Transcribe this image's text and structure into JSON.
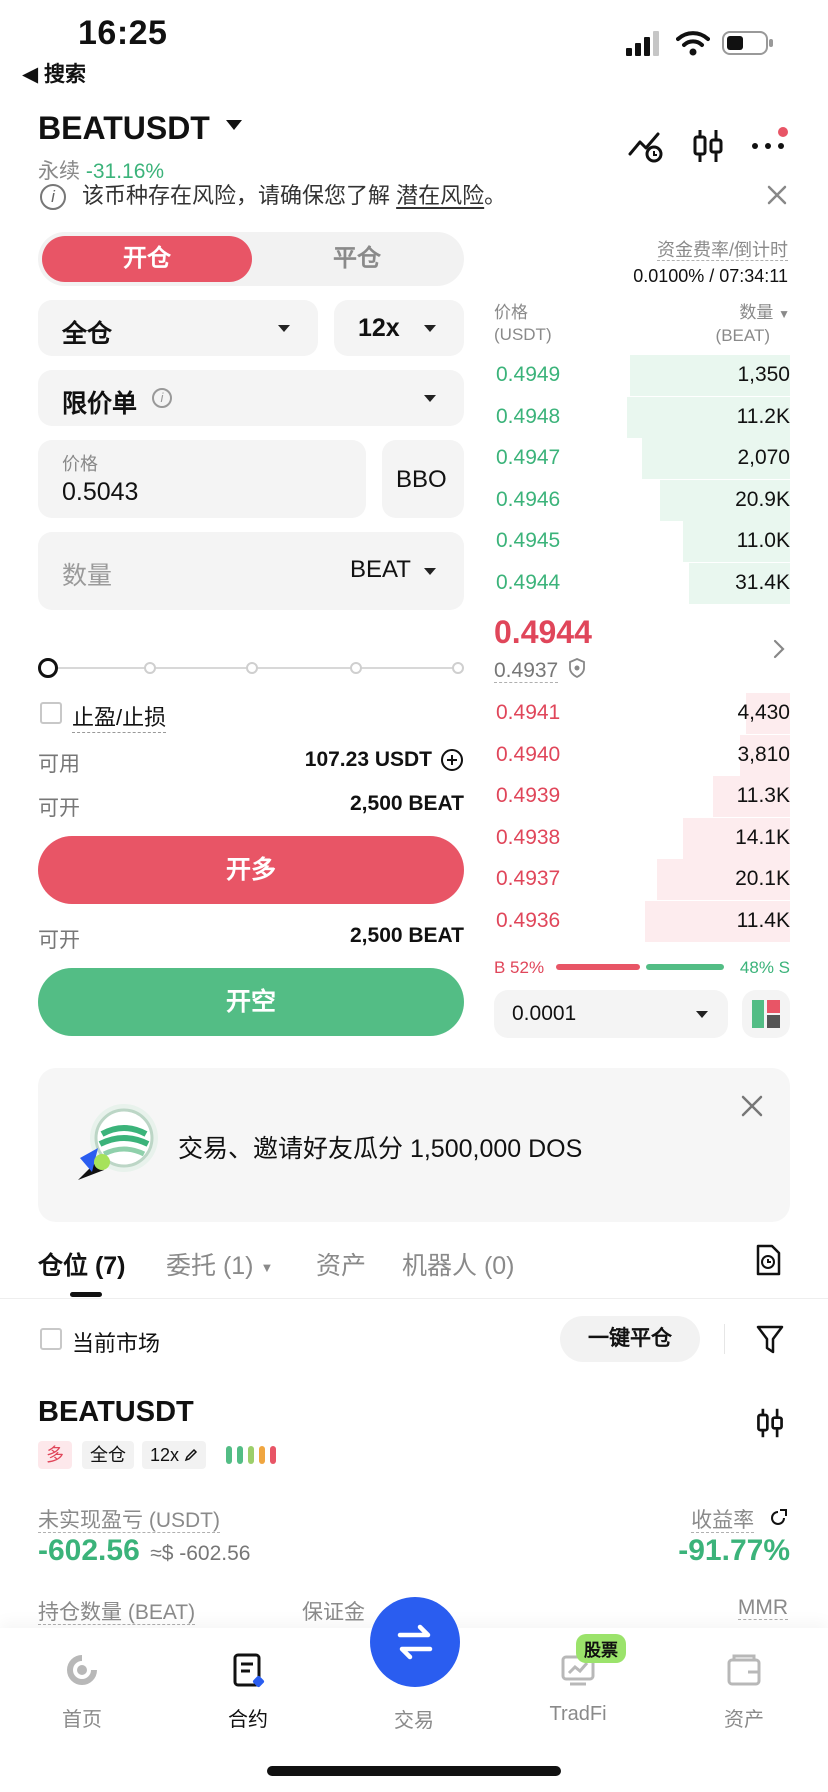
{
  "status_bar": {
    "time": "16:25",
    "back_label": "◀ 搜索"
  },
  "header": {
    "symbol": "BEATUSDT",
    "contract_type": "永续",
    "change_pct": "-31.16%",
    "notice_text": "该币种存在风险，请确保您了解",
    "notice_link": "潜在风险",
    "notice_end": "。"
  },
  "toggle": {
    "open_label": "开仓",
    "close_label": "平仓"
  },
  "funding": {
    "label": "资金费率/倒计时",
    "value": "0.0100% / 07:34:11"
  },
  "form": {
    "margin_mode": "全仓",
    "leverage": "12x",
    "order_type": "限价单",
    "price_label": "价格",
    "price_value": "0.5043",
    "bbo_label": "BBO",
    "qty_placeholder": "数量",
    "qty_unit": "BEAT",
    "tpsl_label": "止盈/止损",
    "available_label": "可用",
    "available_value": "107.23 USDT",
    "can_open_label": "可开",
    "can_open_long": "2,500 BEAT",
    "can_open_short": "2,500 BEAT",
    "long_button": "开多",
    "short_button": "开空"
  },
  "orderbook": {
    "price_header": "价格",
    "price_unit": "(USDT)",
    "qty_header": "数量",
    "qty_unit": "(BEAT)",
    "asks": [
      {
        "price": "0.4949",
        "qty": "1,350",
        "depth": 0.54
      },
      {
        "price": "0.4948",
        "qty": "11.2K",
        "depth": 0.55
      },
      {
        "price": "0.4947",
        "qty": "2,070",
        "depth": 0.5
      },
      {
        "price": "0.4946",
        "qty": "20.9K",
        "depth": 0.44
      },
      {
        "price": "0.4945",
        "qty": "11.0K",
        "depth": 0.36
      },
      {
        "price": "0.4944",
        "qty": "31.4K",
        "depth": 0.34
      }
    ],
    "last_price": "0.4944",
    "mark_price": "0.4937",
    "bids": [
      {
        "price": "0.4941",
        "qty": "4,430",
        "depth": 0.15
      },
      {
        "price": "0.4940",
        "qty": "3,810",
        "depth": 0.17
      },
      {
        "price": "0.4939",
        "qty": "11.3K",
        "depth": 0.26
      },
      {
        "price": "0.4938",
        "qty": "14.1K",
        "depth": 0.36
      },
      {
        "price": "0.4937",
        "qty": "20.1K",
        "depth": 0.45
      },
      {
        "price": "0.4936",
        "qty": "11.4K",
        "depth": 0.49
      }
    ],
    "buy_ratio": "B 52%",
    "sell_ratio": "48% S",
    "buy_fraction": 0.52,
    "precision": "0.0001"
  },
  "banner": {
    "text": "交易、邀请好友瓜分 1,500,000 DOS"
  },
  "tabs": [
    {
      "label": "仓位 (7)"
    },
    {
      "label": "委托 (1)"
    },
    {
      "label": "资产"
    },
    {
      "label": "机器人 (0)"
    }
  ],
  "filter": {
    "current_market_label": "当前市场",
    "close_all_label": "一键平仓"
  },
  "position": {
    "symbol": "BEATUSDT",
    "side_tag": "多",
    "mode_tag": "全仓",
    "leverage_tag": "12x",
    "pnl_label": "未实现盈亏 (USDT)",
    "pnl_value": "-602.56",
    "pnl_approx": "≈$ -602.56",
    "roi_label": "收益率",
    "roi_value": "-91.77%",
    "qty_label": "持仓数量 (BEAT)",
    "margin_label": "保证金",
    "mmr_label": "MMR"
  },
  "bottom_nav": [
    {
      "label": "首页",
      "icon": "home-icon"
    },
    {
      "label": "合约",
      "icon": "contract-icon"
    },
    {
      "label": "交易",
      "icon": "swap-icon"
    },
    {
      "label": "TradFi",
      "icon": "tradfi-icon",
      "badge": "股票"
    },
    {
      "label": "资产",
      "icon": "wallet-icon"
    }
  ],
  "colors": {
    "red": "#e85566",
    "green": "#53bd85",
    "blue": "#2a5df0"
  }
}
